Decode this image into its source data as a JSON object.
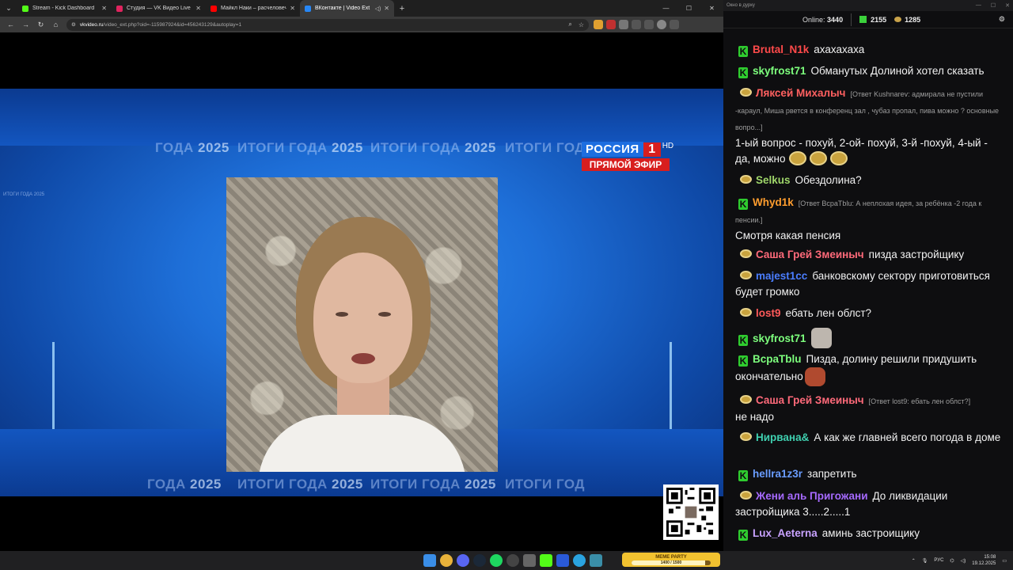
{
  "browser": {
    "tabs": [
      {
        "title": "Stream - Kick Dashboard",
        "color": "#53fc18",
        "active": false,
        "audio": false
      },
      {
        "title": "Студия — VK Видео Live",
        "color": "#e0245e",
        "active": false,
        "audio": false
      },
      {
        "title": "Майкл Наки – расчеловечивание",
        "color": "#ff0000",
        "active": false,
        "audio": false
      },
      {
        "title": "ВКонтакте | Video Ext",
        "color": "#2787f5",
        "active": true,
        "audio": true
      }
    ],
    "url_host": "vkvideo.ru",
    "url_rest": "/video_ext.php?oid=-115987924&id=456243129&autoplay=1"
  },
  "video": {
    "ticker_top": [
      {
        "prefix": "ГОДА ",
        "year": "2025"
      },
      {
        "prefix": "ИТОГИ ГОДА ",
        "year": "2025"
      },
      {
        "prefix": "ИТОГИ ГОДА ",
        "year": "2025"
      },
      {
        "prefix": "ИТОГИ ГОД",
        "year": ""
      }
    ],
    "ticker_bottom": [
      {
        "prefix": "ГОДА ",
        "year": "2025"
      },
      {
        "prefix": "ИТОГИ ГОДА ",
        "year": "2025"
      },
      {
        "prefix": "ИТОГИ ГОДА ",
        "year": "2025"
      },
      {
        "prefix": "ИТОГИ ГОД",
        "year": ""
      }
    ],
    "side_label": "ИТОГИ ГОДА 2025",
    "channel_name": "РОССИЯ",
    "channel_number": "1",
    "channel_hd": "HD",
    "live_label": "ПРЯМОЙ ЭФИР",
    "brand_blue": "#1d6ee0",
    "brand_red": "#d81e1e"
  },
  "chat": {
    "window_title": "Окно в дурку",
    "online_label": "Online:",
    "online_count": "3440",
    "kick_count": "2155",
    "vk_count": "1285",
    "messages": [
      {
        "platform": "kick",
        "user": "Brutal_N1k",
        "color": "#ff4a4a",
        "reply": "",
        "text": "ахахахаха",
        "emotes": []
      },
      {
        "platform": "kick",
        "user": "skyfrost71",
        "color": "#7dff7d",
        "reply": "",
        "text": "Обманутых Долиной хотел сказать",
        "emotes": []
      },
      {
        "platform": "vk",
        "user": "Ляксей Михалыч",
        "color": "#ff6060",
        "reply": "[Ответ Kushnarev: адмирала не пустили -караул, Миша рвется в конференц зал , чубаз пропал, пива можно ? основные вопро...]",
        "text": "1-ый вопрос - похуй, 2-ой- похуй, 3-й -похуй, 4-ый - да, можно",
        "emotes": [
          "duck",
          "duck",
          "duck"
        ]
      },
      {
        "platform": "vk",
        "user": "Selkus",
        "color": "#9fd66a",
        "reply": "",
        "text": "Обездолина?",
        "emotes": []
      },
      {
        "platform": "kick",
        "user": "Whyd1k",
        "color": "#ff9d2e",
        "reply": "[Ответ ВсраТblu: А неплохая идея, за ребёнка -2 года к пенсии.]",
        "text": "Смотря какая пенсия",
        "emotes": []
      },
      {
        "platform": "vk",
        "user": "Саша Грей Змеиныч",
        "color": "#ff6a7a",
        "reply": "",
        "text": "пизда застройщику",
        "emotes": []
      },
      {
        "platform": "vk",
        "user": "majest1cc",
        "color": "#4a7dff",
        "reply": "",
        "text": "банковскому сектору приготовиться будет громко",
        "emotes": []
      },
      {
        "platform": "vk",
        "user": "lost9",
        "color": "#ff5a5a",
        "reply": "",
        "text": "ебать лен облст?",
        "emotes": []
      },
      {
        "platform": "kick",
        "user": "skyfrost71",
        "color": "#7dff7d",
        "reply": "",
        "text": "",
        "emotes": [
          "cat"
        ]
      },
      {
        "platform": "kick",
        "user": "ВсраТblu",
        "color": "#7dff7d",
        "reply": "",
        "text": "Пизда, долину решили придушить окончательно",
        "emotes": [
          "face"
        ]
      },
      {
        "platform": "vk",
        "user": "Саша Грей Змеиныч",
        "color": "#ff6a7a",
        "reply": "[Ответ lost9: ебать лен облст?]",
        "text": "не надо",
        "emotes": []
      },
      {
        "platform": "vk",
        "user": "Нирвана&",
        "color": "#3fd0b0",
        "reply": "",
        "text": "А как же главней всего погода в доме",
        "emotes": []
      },
      {
        "platform": "kick",
        "user": "hellra1z3r",
        "color": "#6a9dff",
        "reply": "",
        "text": "запретить",
        "emotes": []
      },
      {
        "platform": "vk",
        "user": "Жени аль Пригожани",
        "color": "#a66aff",
        "reply": "",
        "text": "До ликвидации застройщика 3.....2.....1",
        "emotes": []
      },
      {
        "platform": "kick",
        "user": "Lux_Aeterna",
        "color": "#c8a2ff",
        "reply": "",
        "text": "аминь застроищику",
        "emotes": []
      }
    ]
  },
  "taskbar": {
    "meme_label": "MEME PARTY",
    "meme_progress": "1400 / 1500",
    "meme_fraction": 0.93,
    "lang": "РУС",
    "time": "15:08",
    "date": "19.12.2025"
  }
}
